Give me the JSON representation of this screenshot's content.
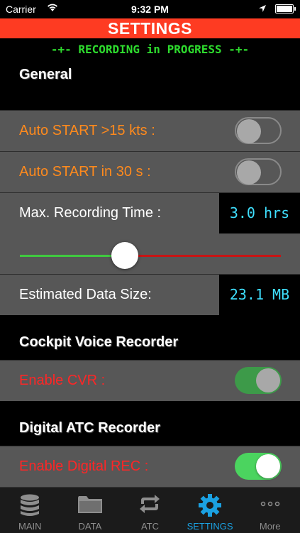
{
  "status_bar": {
    "carrier": "Carrier",
    "time": "9:32 PM"
  },
  "title": "SETTINGS",
  "recording_status": "-+- RECORDING in PROGRESS -+-",
  "sections": {
    "general": {
      "header": "General",
      "auto_start_speed_label": "Auto START >15 kts :",
      "auto_start_speed_on": false,
      "auto_start_time_label": "Auto START in 30 s :",
      "auto_start_time_on": false,
      "max_time_label": "Max. Recording Time :",
      "max_time_value": "3.0 hrs",
      "max_time_slider_fraction": 0.35,
      "data_size_label": "Estimated Data Size:",
      "data_size_value": "23.1 MB"
    },
    "cvr": {
      "header": "Cockpit Voice Recorder",
      "enable_label": "Enable CVR :",
      "enable_on": true
    },
    "atc": {
      "header": "Digital ATC Recorder",
      "enable_label": "Enable Digital REC :",
      "enable_on": true
    }
  },
  "tabs": [
    {
      "label": "MAIN",
      "icon": "database-icon",
      "active": false
    },
    {
      "label": "DATA",
      "icon": "folder-icon",
      "active": false
    },
    {
      "label": "ATC",
      "icon": "repeat-icon",
      "active": false
    },
    {
      "label": "SETTINGS",
      "icon": "gear-icon",
      "active": true
    },
    {
      "label": "More",
      "icon": "more-icon",
      "active": false
    }
  ],
  "colors": {
    "title_bar": "#fe3b22",
    "status_text": "#2edc2e",
    "value_text": "#3fe0ff",
    "active_tab": "#1ba1e2"
  }
}
